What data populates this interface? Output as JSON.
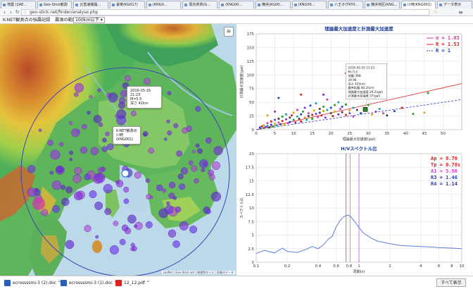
{
  "tabs": [
    {
      "label": "地震 (1AE..."
    },
    {
      "label": "Geo-Stick観測"
    },
    {
      "label": "災害速報履..."
    },
    {
      "label": "最寄(KG017)"
    },
    {
      "label": "(KNG0..."
    },
    {
      "label": "岡内県県(G..."
    },
    {
      "label": "(KNG00..."
    },
    {
      "label": "横浜(KG00..."
    },
    {
      "label": "(KNG00..."
    },
    {
      "label": "八王子(TKY0..."
    },
    {
      "label": "横浜地区(KNG..."
    },
    {
      "label": "川崎(KNG001)"
    },
    {
      "label": "データ表示"
    }
  ],
  "address": {
    "url": "geo-stick.net/finder/analyse.php"
  },
  "toolbar": {
    "station_label": "K-NET観測点の強震記録",
    "range_label": "震源の範囲:",
    "range_value": "100km以下 ▾"
  },
  "map": {
    "attribution": "Leaflet | Geo-Stick.net | 地理院タイル | 気象庁データ",
    "popup_quake": {
      "line1": "2016-05-16 21:23",
      "line2": "M=5.5",
      "line3": "深さ 42km"
    },
    "popup_station": {
      "line1": "K-NET観測点",
      "line2": "川崎(KNG001)"
    }
  },
  "chart_top": {
    "title": "理論最大加速度と計測最大加速度",
    "xlabel": "理論最大加速度(gal)",
    "ylabel": "計測最大加速度(gal)",
    "legend": [
      {
        "label": "σ = 1.03",
        "color": "#d83a8a"
      },
      {
        "label": "R = 1.53",
        "color": "#e02020"
      },
      {
        "label": "R = 1",
        "color": "#2a3fb0"
      }
    ],
    "tooltip": {
      "line1": "2016-05-16 21:23",
      "line2": "M=5.5",
      "line3": "地震:39N",
      "line4": "39.96",
      "line5": "深さ 42(km)",
      "line6": "震央距離:48.2(km)",
      "line7": "理論最大加速度:29.2(gal)",
      "line8": "計測最大加速度:37(gal)"
    },
    "chart_data": {
      "type": "scatter",
      "xlim": [
        0,
        55
      ],
      "ylim": [
        0,
        175
      ],
      "xticks": [
        "0",
        "5",
        "10",
        "15",
        "20",
        "25",
        "30",
        "35",
        "40",
        "45",
        "50"
      ],
      "yticks": [
        "0",
        "25",
        "50",
        "75",
        "100",
        "125",
        "150",
        "175"
      ],
      "points": [
        [
          1,
          4
        ],
        [
          1.5,
          6
        ],
        [
          2,
          3
        ],
        [
          2,
          8
        ],
        [
          2.5,
          5
        ],
        [
          3,
          7
        ],
        [
          3,
          12
        ],
        [
          3.5,
          4
        ],
        [
          4,
          9
        ],
        [
          4,
          15
        ],
        [
          4.5,
          6
        ],
        [
          5,
          11
        ],
        [
          5,
          18
        ],
        [
          5.5,
          8
        ],
        [
          6,
          13
        ],
        [
          6,
          20
        ],
        [
          6.5,
          10
        ],
        [
          7,
          16
        ],
        [
          7,
          24
        ],
        [
          7.5,
          9
        ],
        [
          8,
          19
        ],
        [
          8,
          28
        ],
        [
          8.5,
          12
        ],
        [
          9,
          22
        ],
        [
          9,
          14
        ],
        [
          9.5,
          26
        ],
        [
          10,
          18
        ],
        [
          10,
          31
        ],
        [
          10.5,
          13
        ],
        [
          11,
          24
        ],
        [
          11,
          36
        ],
        [
          11.5,
          20
        ],
        [
          12,
          28
        ],
        [
          12,
          15
        ],
        [
          12.5,
          33
        ],
        [
          13,
          22
        ],
        [
          13,
          40
        ],
        [
          13.5,
          18
        ],
        [
          14,
          30
        ],
        [
          14,
          25
        ],
        [
          14.5,
          44
        ],
        [
          15,
          27
        ],
        [
          15,
          20
        ],
        [
          15.5,
          35
        ],
        [
          16,
          29
        ],
        [
          16,
          48
        ],
        [
          16.5,
          23
        ],
        [
          17,
          38
        ],
        [
          17,
          31
        ],
        [
          17.5,
          26
        ],
        [
          18,
          42
        ],
        [
          18,
          34
        ],
        [
          18.5,
          22
        ],
        [
          19,
          36
        ],
        [
          19,
          55
        ],
        [
          20,
          30
        ],
        [
          20,
          40
        ],
        [
          20.5,
          25
        ],
        [
          21,
          45
        ],
        [
          21,
          33
        ],
        [
          22,
          28
        ],
        [
          22,
          50
        ],
        [
          22.5,
          38
        ],
        [
          23,
          32
        ],
        [
          23,
          42
        ],
        [
          24,
          27
        ],
        [
          24,
          46
        ],
        [
          25,
          35
        ],
        [
          25,
          30
        ],
        [
          26,
          40
        ],
        [
          26,
          24
        ],
        [
          27,
          36
        ],
        [
          28,
          30
        ],
        [
          29.2,
          37
        ],
        [
          30,
          45
        ],
        [
          31,
          28
        ],
        [
          32,
          33
        ],
        [
          33,
          38
        ],
        [
          34,
          30
        ],
        [
          35,
          26
        ],
        [
          37,
          34
        ],
        [
          39,
          40
        ],
        [
          42,
          29
        ],
        [
          45,
          31
        ],
        [
          18,
          64
        ],
        [
          26,
          62
        ],
        [
          24,
          103
        ],
        [
          31,
          92
        ],
        [
          6,
          58
        ],
        [
          12,
          64
        ],
        [
          46,
          67
        ],
        [
          3,
          26
        ],
        [
          5,
          33
        ]
      ],
      "fit_red": {
        "slope": 1.53
      },
      "fit_blue": {
        "slope": 1
      }
    }
  },
  "chart_bottom": {
    "title": "H/Vスペクトル比",
    "xlabel": "周期(s)",
    "ylabel": "スペクトル比",
    "params": [
      {
        "label": "Ap = 8.70",
        "color": "#e02020"
      },
      {
        "label": "Tp = 0.78s",
        "color": "#e02020"
      },
      {
        "label": "A1 = 5.96",
        "color": "#d83adf"
      },
      {
        "label": "R3 = 1.46",
        "color": "#2a3fb0"
      },
      {
        "label": "R4 = 1.14",
        "color": "#2a3fb0"
      }
    ],
    "chart_data": {
      "type": "line",
      "xscale": "log",
      "xlim": [
        0.1,
        10
      ],
      "ylim": [
        0,
        20
      ],
      "xticks": [
        "0.1",
        "0.2",
        "0.4",
        "0.6",
        "0.8",
        "1",
        "2",
        "4",
        "6",
        "8",
        "10"
      ],
      "yticks": [
        "0",
        "2.5",
        "5",
        "7.5",
        "10",
        "12.5",
        "15",
        "17.5",
        "20"
      ],
      "x": [
        0.1,
        0.12,
        0.15,
        0.18,
        0.2,
        0.25,
        0.3,
        0.35,
        0.4,
        0.45,
        0.5,
        0.55,
        0.6,
        0.65,
        0.7,
        0.75,
        0.78,
        0.82,
        0.9,
        1.0,
        1.1,
        1.3,
        1.5,
        2,
        2.5,
        3,
        4,
        5,
        6,
        8,
        10
      ],
      "y": [
        1.6,
        2.2,
        1.7,
        2.6,
        2.0,
        1.8,
        2.3,
        2.9,
        2.5,
        3.2,
        4.2,
        4.8,
        6.5,
        7.6,
        8.3,
        8.6,
        8.7,
        8.5,
        7.6,
        6.4,
        5.4,
        4.5,
        3.9,
        3.4,
        3.1,
        3.0,
        2.9,
        2.8,
        2.7,
        2.6,
        2.5
      ],
      "peak_period": 0.78,
      "marker_periods": [
        0.75,
        0.82,
        1.0
      ]
    }
  },
  "taskbar": {
    "downloads": [
      {
        "label": "ecrossssmi-3 (2).doc ^",
        "color": "#2b5fb8"
      },
      {
        "label": "ecrossssmi-3 (1).doc ^",
        "color": "#2b5fb8"
      },
      {
        "label": "12_12.pdf ^",
        "color": "#d22"
      }
    ],
    "show_all": "すべて表示"
  }
}
